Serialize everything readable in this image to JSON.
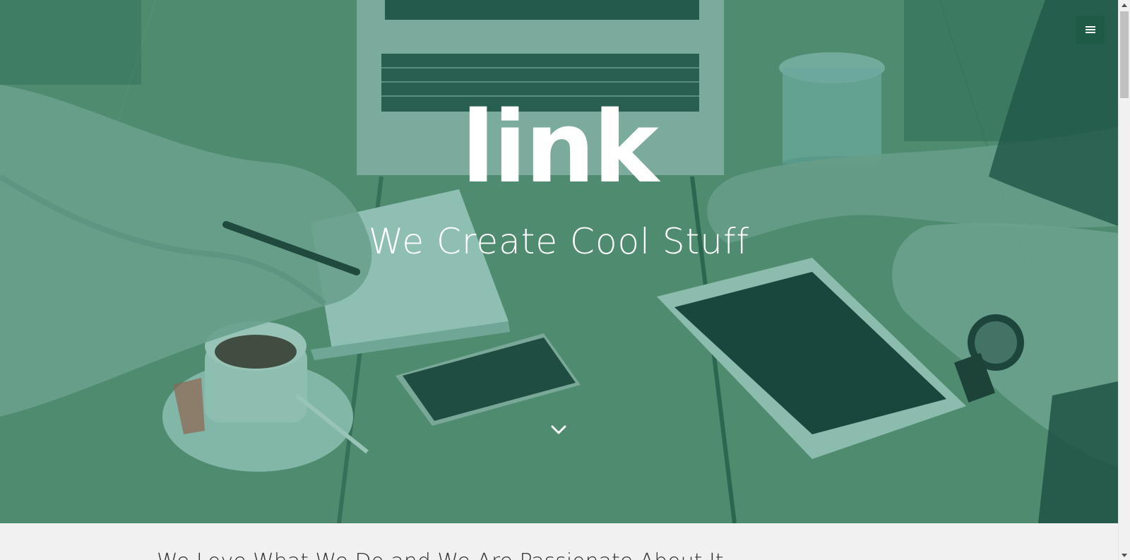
{
  "hero": {
    "title": "link",
    "subtitle": "We Create Cool Stuff"
  },
  "menu": {
    "icon": "hamburger-menu-icon"
  },
  "scroll_down": {
    "icon": "chevron-down-icon"
  },
  "intro": {
    "text": "We Love What We Do and We Are Passionate About It"
  },
  "colors": {
    "hero_tint": "#4f8a6b",
    "menu_button_bg": "#1f5a46",
    "page_background": "#f1f1f1",
    "text_white": "#ffffff"
  }
}
